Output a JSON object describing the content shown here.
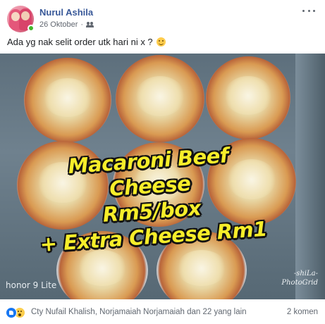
{
  "post": {
    "author": "Nurul Ashila",
    "date": "26 Oktober",
    "separator": "·",
    "privacy_icon": "friends-icon",
    "more_icon": "more-horizontal-icon",
    "text": "Ada yg nak selit order utk hari ni x ?",
    "emoji": "smile-emoji"
  },
  "photo": {
    "overlay_lines": [
      "Macaroni Beef Cheese",
      "Rm5/box",
      "+ Extra Cheese Rm1"
    ],
    "brand_watermark": "honor 9 Lite",
    "signature": "-shiLa-",
    "signature_app": "PhotoGrid"
  },
  "footer": {
    "reaction_icons": [
      "like-reaction-icon",
      "wow-reaction-icon"
    ],
    "reactors": "Cty Nufail Khalish, Norjamaiah Norjamaiah dan 22 yang lain",
    "comments": "2 komen"
  },
  "colors": {
    "author": "#385898",
    "overlay_text": "#f7ee2a",
    "like": "#1877f2",
    "online": "#42b72a"
  }
}
